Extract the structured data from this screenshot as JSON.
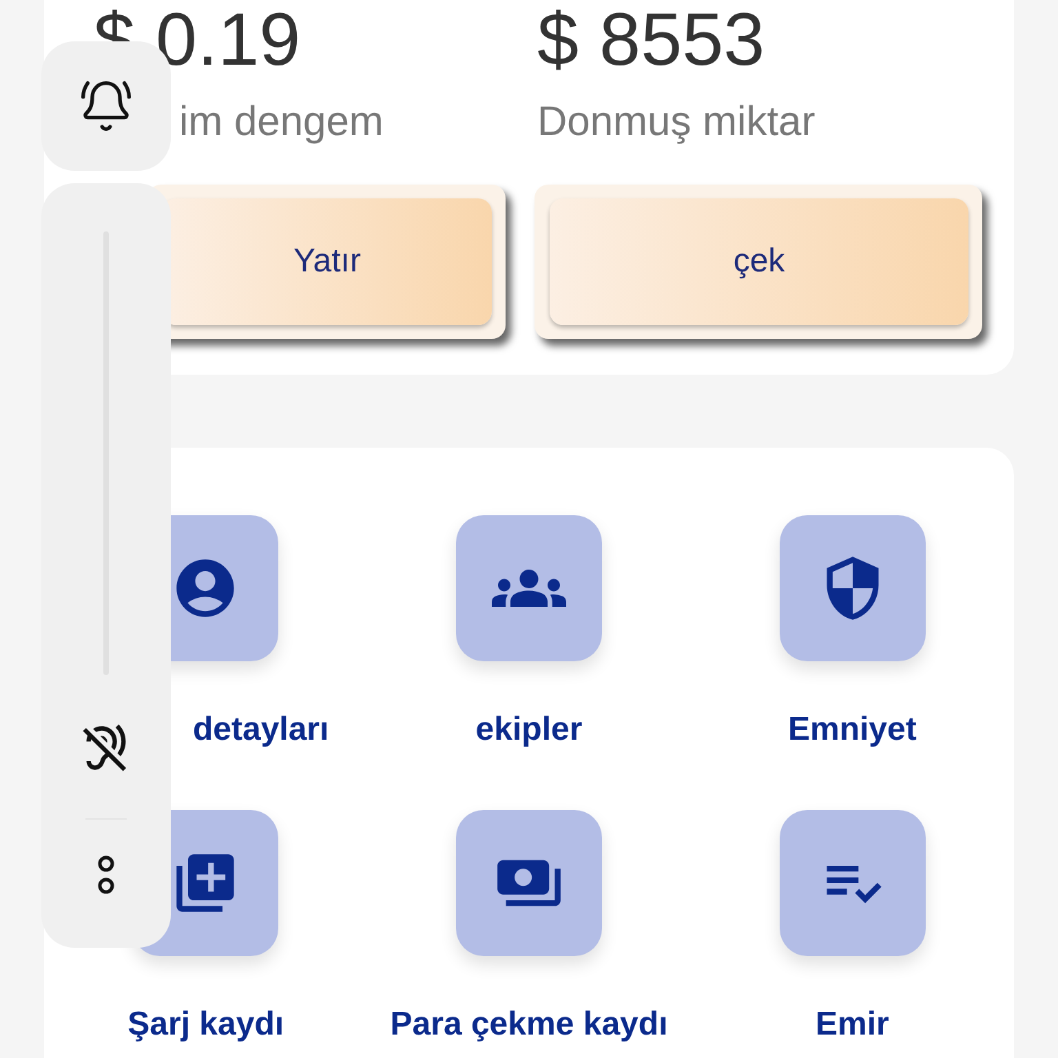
{
  "balances": [
    {
      "amount": "$ 0.19",
      "label": "im dengem"
    },
    {
      "amount": "$ 8553",
      "label": "Donmuş miktar"
    }
  ],
  "actions": [
    {
      "label": "Yatır"
    },
    {
      "label": "çek"
    }
  ],
  "menu": [
    {
      "label": "detayları",
      "kind": "account"
    },
    {
      "label": "ekipler",
      "kind": "groups"
    },
    {
      "label": "Emniyet",
      "kind": "shield"
    },
    {
      "label": "Şarj kaydı",
      "kind": "add"
    },
    {
      "label": "Para çekme kaydı",
      "kind": "payments"
    },
    {
      "label": "Emir",
      "kind": "checklist"
    }
  ],
  "volume_panel": {
    "level": 0
  }
}
